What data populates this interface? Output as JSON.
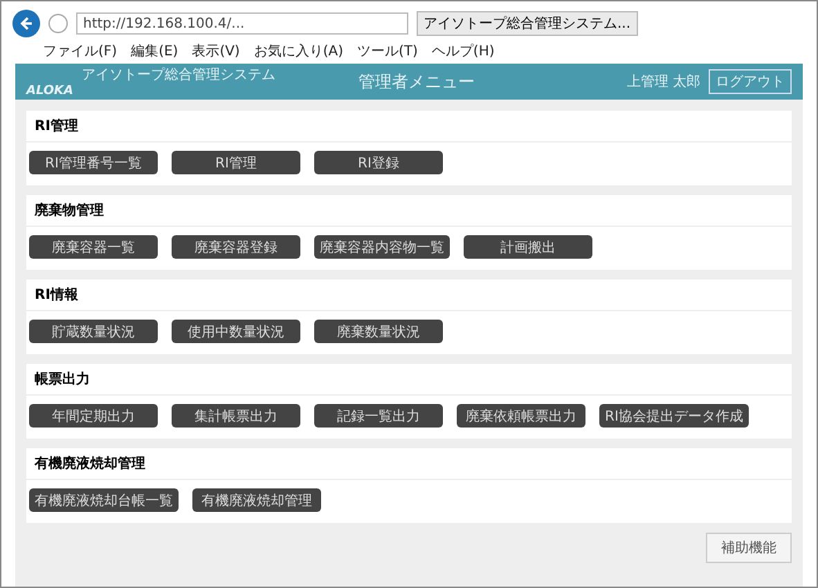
{
  "browser": {
    "url": "http://192.168.100.4/...",
    "tab_title": "アイソトープ総合管理システム...",
    "menu": [
      "ファイル(F)",
      "編集(E)",
      "表示(V)",
      "お気に入り(A)",
      "ツール(T)",
      "ヘルプ(H)"
    ]
  },
  "header": {
    "system_name": "アイソトープ総合管理システム",
    "logo": "ALOKA",
    "title": "管理者メニュー",
    "user": "上管理 太郎",
    "logout": "ログアウト"
  },
  "sections": [
    {
      "title": "RI管理",
      "buttons": [
        "RI管理番号一覧",
        "RI管理",
        "RI登録"
      ]
    },
    {
      "title": "廃棄物管理",
      "buttons": [
        "廃棄容器一覧",
        "廃棄容器登録",
        "廃棄容器内容物一覧",
        "計画搬出"
      ]
    },
    {
      "title": "RI情報",
      "buttons": [
        "貯蔵数量状況",
        "使用中数量状況",
        "廃棄数量状況"
      ]
    },
    {
      "title": "帳票出力",
      "buttons": [
        "年間定期出力",
        "集計帳票出力",
        "記録一覧出力",
        "廃棄依頼帳票出力",
        "RI協会提出データ作成"
      ]
    },
    {
      "title": "有機廃液焼却管理",
      "buttons": [
        "有機廃液焼却台帳一覧",
        "有機廃液焼却管理"
      ]
    }
  ],
  "footer_button": "補助機能"
}
